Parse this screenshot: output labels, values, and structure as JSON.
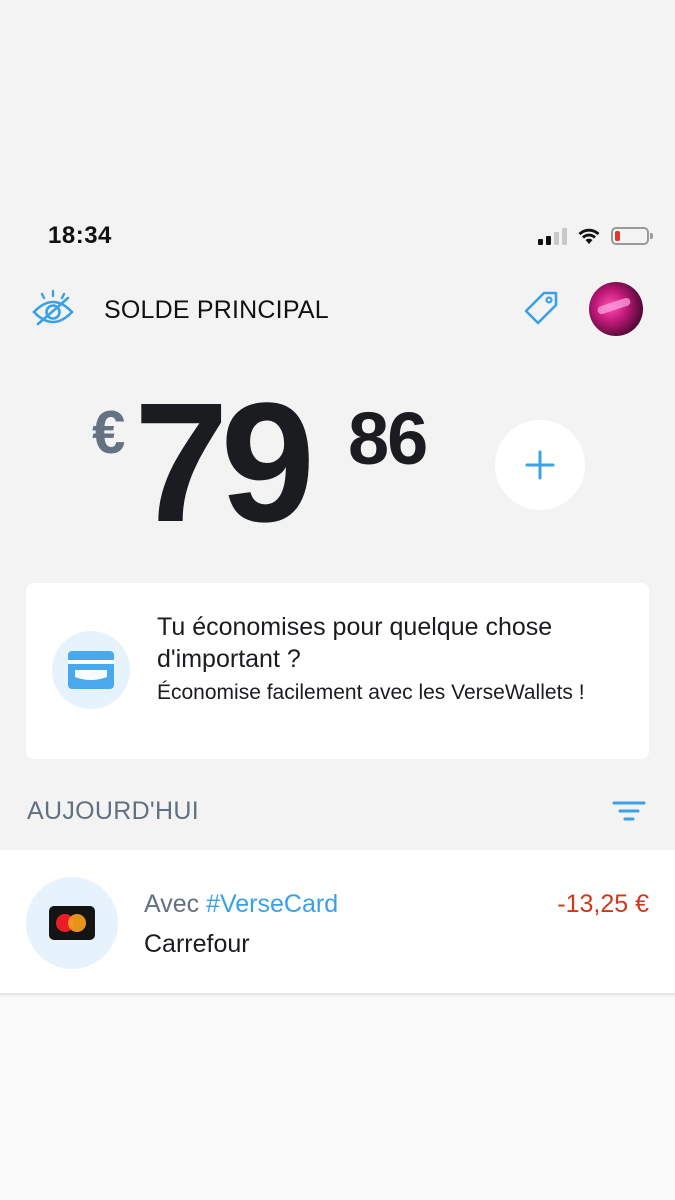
{
  "status_bar": {
    "time": "18:34"
  },
  "header": {
    "title": "SOLDE PRINCIPAL"
  },
  "balance": {
    "currency": "€",
    "integer": "79",
    "decimals": "86"
  },
  "promo": {
    "title": "Tu économises pour quelque chose d'important ?",
    "subtitle": "Économise facilement avec les VerseWallets !"
  },
  "section": {
    "title": "AUJOURD'HUI"
  },
  "transactions": [
    {
      "prefix": "Avec ",
      "tag": "#VerseCard",
      "merchant": "Carrefour ",
      "amount": "-13,25 €"
    }
  ],
  "colors": {
    "accent": "#3aa1e8",
    "negative": "#d3371b",
    "muted": "#627181",
    "battery_low": "#e2352b"
  },
  "icons": [
    "eye-slash-icon",
    "tag-icon",
    "plus-icon",
    "wallet-card-icon",
    "filter-icon",
    "mastercard-icon",
    "wifi-icon",
    "signal-icon",
    "battery-icon"
  ]
}
